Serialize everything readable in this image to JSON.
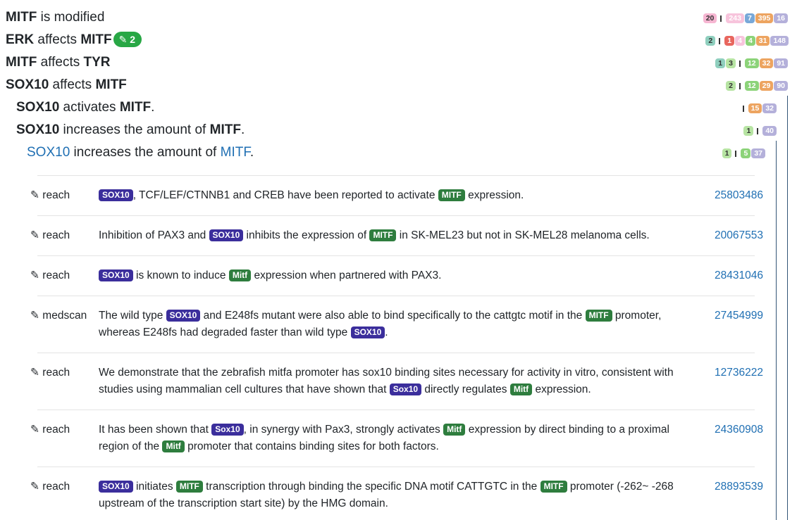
{
  "colors": {
    "pink": "#f6b6d2",
    "light_pink": "#f7c4dc",
    "blue": "#78a8d8",
    "orange": "#eda460",
    "lavender": "#b4b0da",
    "teal": "#8fcfbe",
    "red": "#e8665e",
    "green": "#8cd379",
    "light_green": "#b7e4a3",
    "link": "#1f6fb3",
    "gene_tag": "#3b2e9c",
    "mitf_tag": "#2e7d3e",
    "pill": "#28a745"
  },
  "statements": [
    {
      "subject": "MITF",
      "verb": "is modified",
      "object": "",
      "badges_left": [
        "20"
      ],
      "badges_right": [
        "243",
        "7",
        "395",
        "16"
      ]
    },
    {
      "subject": "ERK",
      "verb": "affects",
      "object": "MITF",
      "curation_count": "2",
      "badges_left": [
        "2"
      ],
      "badges_right": [
        "1",
        "4",
        "4",
        "31",
        "148"
      ]
    },
    {
      "subject": "MITF",
      "verb": "affects",
      "object": "TYR",
      "badges_left": [
        "1",
        "3"
      ],
      "badges_right": [
        "12",
        "32",
        "91"
      ]
    },
    {
      "subject": "SOX10",
      "verb": "affects",
      "object": "MITF",
      "badges_left": [
        "2"
      ],
      "badges_right": [
        "12",
        "29",
        "90"
      ]
    },
    {
      "subject": "SOX10",
      "verb": "activates",
      "object": "MITF",
      "punct": ".",
      "badges_left": [],
      "badges_right": [
        "15",
        "32"
      ]
    },
    {
      "subject": "SOX10",
      "verb": "increases the amount of",
      "object": "MITF",
      "punct": ".",
      "badges_left": [
        "1"
      ],
      "badges_right": [
        "40"
      ]
    },
    {
      "subject": "SOX10",
      "verb": "increases the amount of",
      "object": "MITF",
      "punct": ".",
      "badges_left": [
        "1"
      ],
      "badges_right": [
        "5",
        "37"
      ]
    }
  ],
  "evidence": [
    {
      "source": "✎ reach",
      "pmid": "25803486"
    },
    {
      "source": "✎ reach",
      "pmid": "20067553"
    },
    {
      "source": "✎ reach",
      "pmid": "28431046"
    },
    {
      "source": "✎ medscan",
      "pmid": "27454999"
    },
    {
      "source": "✎ reach",
      "pmid": "12736222"
    },
    {
      "source": "✎ reach",
      "pmid": "24360908"
    },
    {
      "source": "✎ reach",
      "pmid": "28893539"
    }
  ],
  "sentences": {
    "e1": [
      ", TCF/LEF/CTNNB1 and CREB have been reported to activate ",
      " expression."
    ],
    "e1_tags": [
      "SOX10",
      "MITF"
    ],
    "e2": [
      "Inhibition of PAX3 and ",
      " inhibits the expression of ",
      " in SK-MEL23 but not in SK-MEL28 melanoma cells."
    ],
    "e2_tags": [
      "SOX10",
      "MITF"
    ],
    "e3": [
      " is known to induce ",
      " expression when partnered with PAX3."
    ],
    "e3_tags": [
      "SOX10",
      "Mitf"
    ],
    "e4": [
      "The wild type ",
      " and E248fs mutant were also able to bind specifically to the cattgtc motif in the ",
      " promoter, whereas E248fs had degraded faster than wild type ",
      "."
    ],
    "e4_tags": [
      "SOX10",
      "MITF",
      "SOX10"
    ],
    "e5": [
      "We demonstrate that the zebrafish mitfa promoter has sox10 binding sites necessary for activity in vitro, consistent with studies using mammalian cell cultures that have shown that ",
      " directly regulates ",
      " expression."
    ],
    "e5_tags": [
      "Sox10",
      "Mitf"
    ],
    "e6": [
      "It has been shown that ",
      ", in synergy with Pax3, strongly activates ",
      " expression by direct binding to a proximal region of the ",
      " promoter that contains binding sites for both factors."
    ],
    "e6_tags": [
      "Sox10",
      "Mitf",
      "Mitf"
    ],
    "e7": [
      " initiates ",
      " transcription through binding the specific DNA motif CATTGTC in the ",
      " promoter (-262~ -268 upstream of the transcription start site) by the HMG domain."
    ],
    "e7_tags": [
      "SOX10",
      "MITF",
      "MITF"
    ]
  }
}
